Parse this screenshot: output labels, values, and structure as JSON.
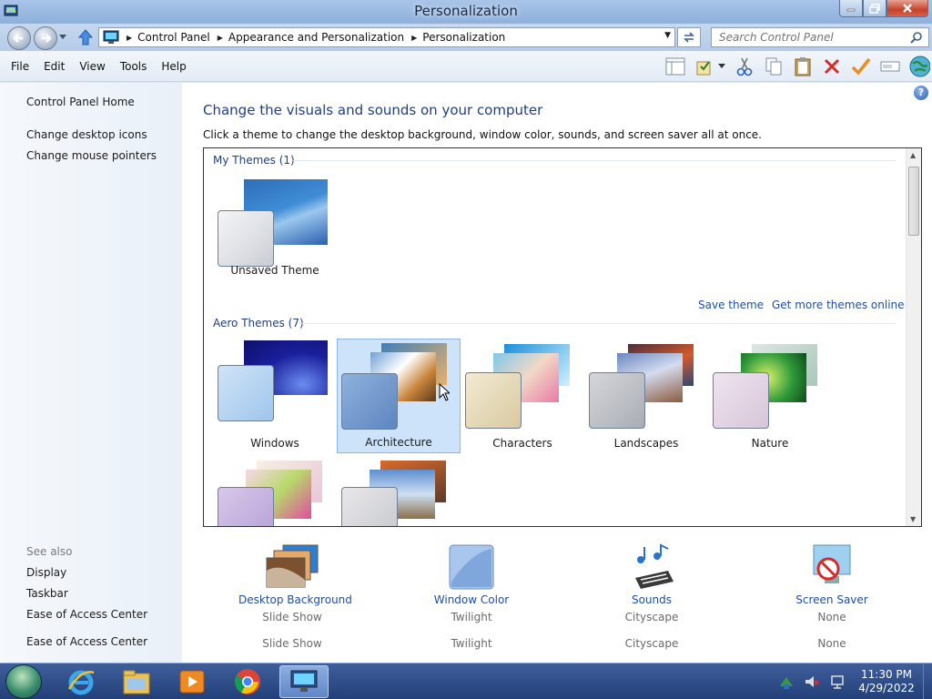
{
  "window": {
    "title": "Personalization"
  },
  "address": {
    "breadcrumbs": [
      "Control Panel",
      "Appearance and Personalization",
      "Personalization"
    ],
    "search_placeholder": "Search Control Panel"
  },
  "menu": [
    "File",
    "Edit",
    "View",
    "Tools",
    "Help"
  ],
  "sidebar": {
    "home": "Control Panel Home",
    "tasks": [
      "Change desktop icons",
      "Change mouse pointers"
    ],
    "see_also_label": "See also",
    "see_also": [
      "Display",
      "Taskbar",
      "Ease of Access Center",
      "Ease of Access Center"
    ]
  },
  "main": {
    "heading": "Change the visuals and sounds on your computer",
    "subheading": "Click a theme to change the desktop background, window color, sounds, and screen saver all at once.",
    "my_themes_label": "My Themes (1)",
    "my_themes": [
      {
        "name": "Unsaved Theme"
      }
    ],
    "save_theme": "Save theme",
    "get_more": "Get more themes online",
    "aero_label": "Aero Themes (7)",
    "aero_themes": [
      {
        "name": "Windows"
      },
      {
        "name": "Architecture",
        "selected": true
      },
      {
        "name": "Characters"
      },
      {
        "name": "Landscapes"
      },
      {
        "name": "Nature"
      },
      {
        "name": ""
      },
      {
        "name": ""
      }
    ]
  },
  "settings": [
    {
      "name": "Desktop Background",
      "value": "Slide Show",
      "value2": "Slide Show"
    },
    {
      "name": "Window Color",
      "value": "Twilight",
      "value2": "Twilight"
    },
    {
      "name": "Sounds",
      "value": "Cityscape",
      "value2": "Cityscape"
    },
    {
      "name": "Screen Saver",
      "value": "None",
      "value2": "None"
    }
  ],
  "taskbar": {
    "time": "11:30 PM",
    "date": "4/29/2022"
  },
  "colors": {
    "link": "#1f4fa0",
    "heading": "#1f3f82",
    "selected": "#cde3f9"
  }
}
